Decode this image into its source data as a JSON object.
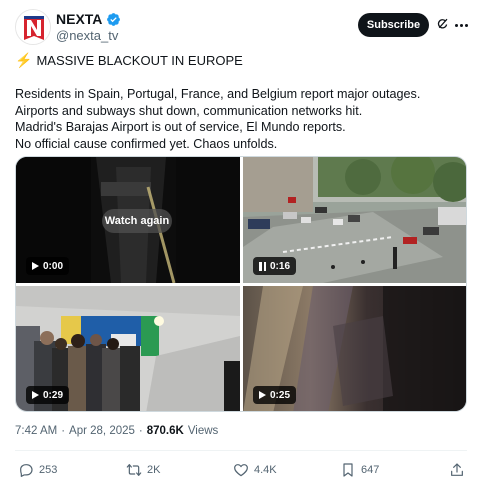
{
  "author": {
    "display_name": "NEXTA",
    "handle": "@nexta_tv",
    "avatar_icon": "nexta-logo",
    "verified_icon": "verified-badge-icon"
  },
  "header": {
    "subscribe_label": "Subscribe",
    "grok_icon": "grok-icon",
    "more_icon": "more-icon"
  },
  "post": {
    "headline_icon": "lightning-bolt",
    "headline": "MASSIVE BLACKOUT IN EUROPE",
    "lines": [
      "Residents in Spain, Portugal, France, and Belgium report major outages.",
      "Airports and subways shut down, communication networks hit.",
      "Madrid's Barajas Airport is out of service, El Mundo reports.",
      "No official cause confirmed yet. Chaos unfolds."
    ]
  },
  "media": [
    {
      "time": "0:00",
      "state": "play",
      "overlay": "Watch again"
    },
    {
      "time": "0:16",
      "state": "pause"
    },
    {
      "time": "0:29",
      "state": "play"
    },
    {
      "time": "0:25",
      "state": "play"
    }
  ],
  "meta": {
    "time": "7:42 AM",
    "separator": "·",
    "date": "Apr 28, 2025",
    "views_count": "870.6K",
    "views_label": "Views"
  },
  "actions": {
    "replies": "253",
    "reposts": "2K",
    "likes": "4.4K",
    "bookmarks": "647"
  },
  "colors": {
    "text": "#0f1419",
    "secondary": "#536471",
    "verified": "#1d9bf0",
    "brand_red": "#d6242f",
    "bolt": "#f5b400"
  }
}
